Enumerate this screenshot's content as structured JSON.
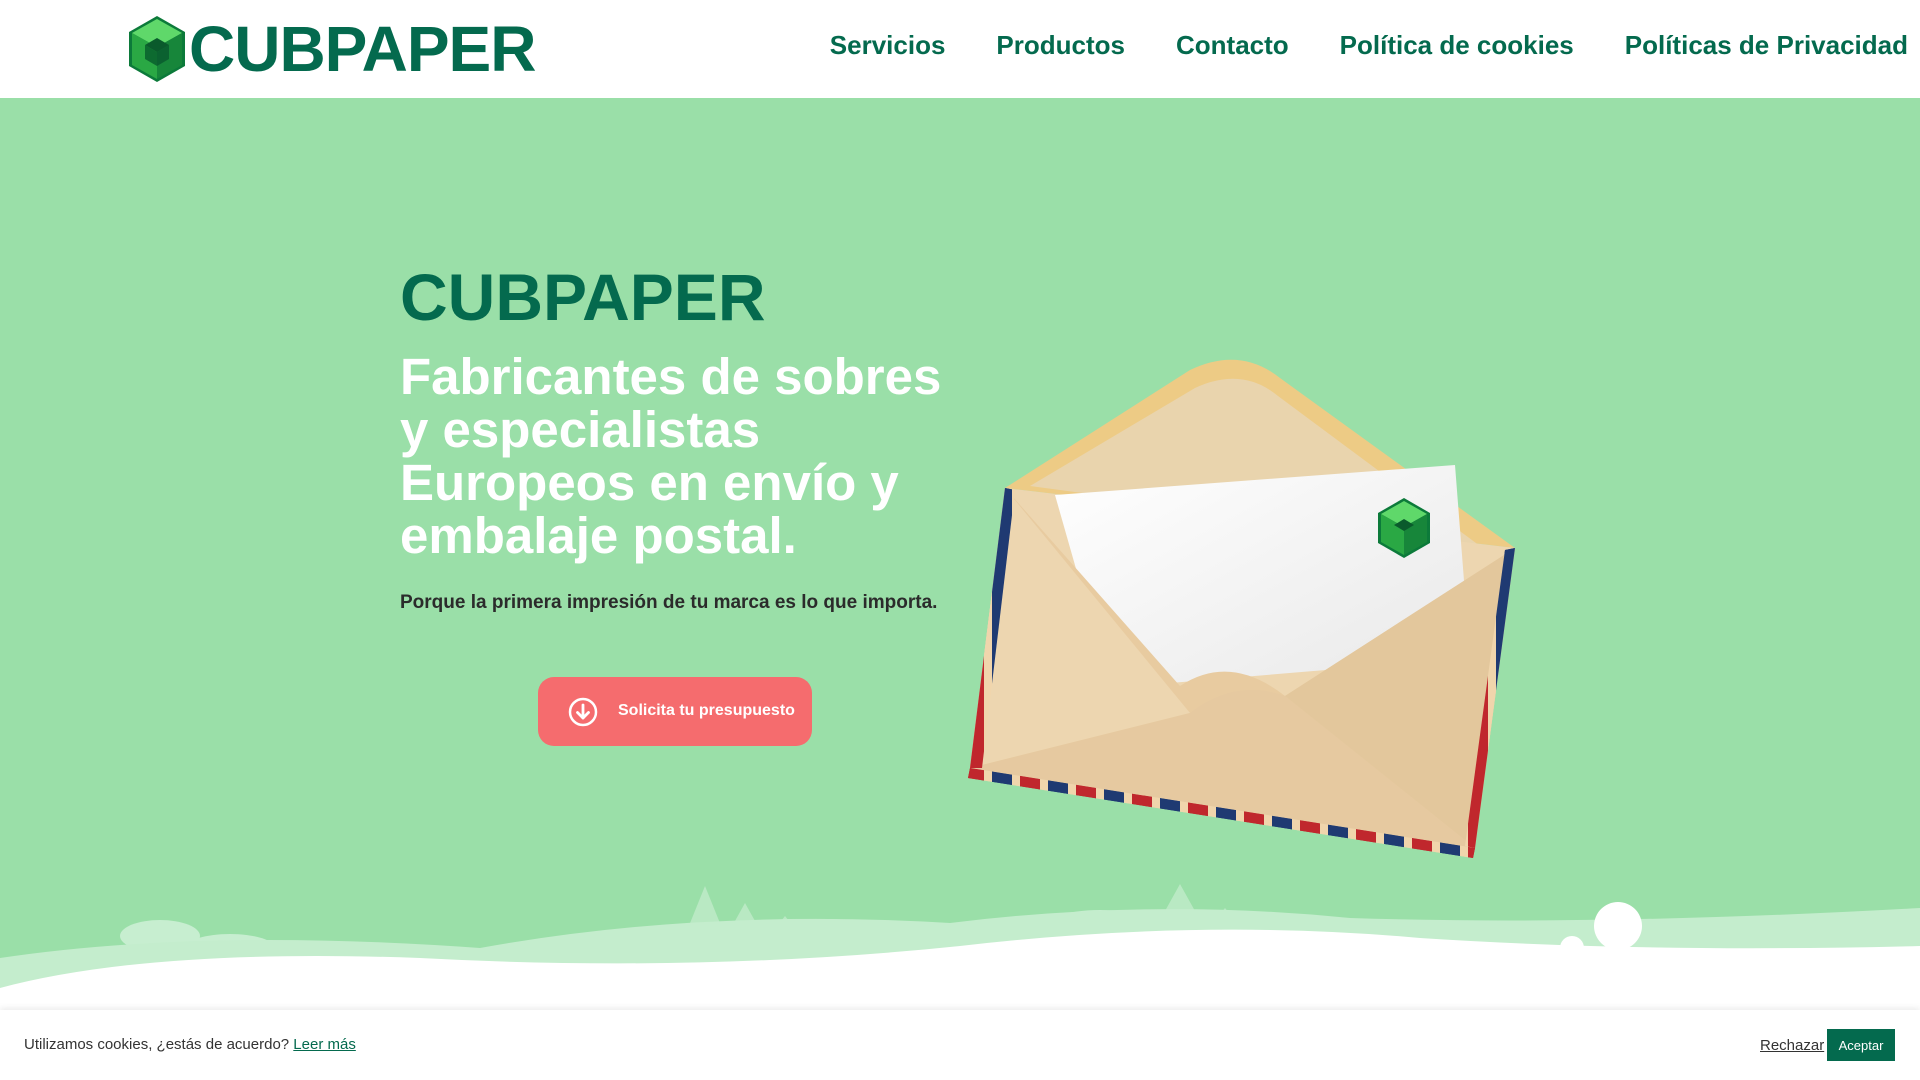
{
  "header": {
    "logo_text": "CUBPAPER",
    "nav": [
      {
        "label": "Servicios"
      },
      {
        "label": "Productos"
      },
      {
        "label": "Contacto"
      },
      {
        "label": "Política de cookies"
      },
      {
        "label": "Políticas de Privacidad"
      }
    ]
  },
  "hero": {
    "brand": "CUBPAPER",
    "heading": "Fabricantes de sobres y especialistas Europeos en envío y embalaje postal.",
    "tagline": "Porque la primera impresión de tu marca es lo que importa.",
    "cta_label": "Solicita tu presupuesto",
    "cta_icon": "arrow-down-circle-icon"
  },
  "cookie_bar": {
    "text": "Utilizamos cookies, ¿estás de acuerdo?",
    "read_more": "Leer más",
    "reject": "Rechazar",
    "accept": "Aceptar"
  },
  "colors": {
    "brand_green": "#046a4e",
    "hero_bg": "#9adfa8",
    "cta_red": "#f56c6e",
    "white": "#ffffff"
  }
}
